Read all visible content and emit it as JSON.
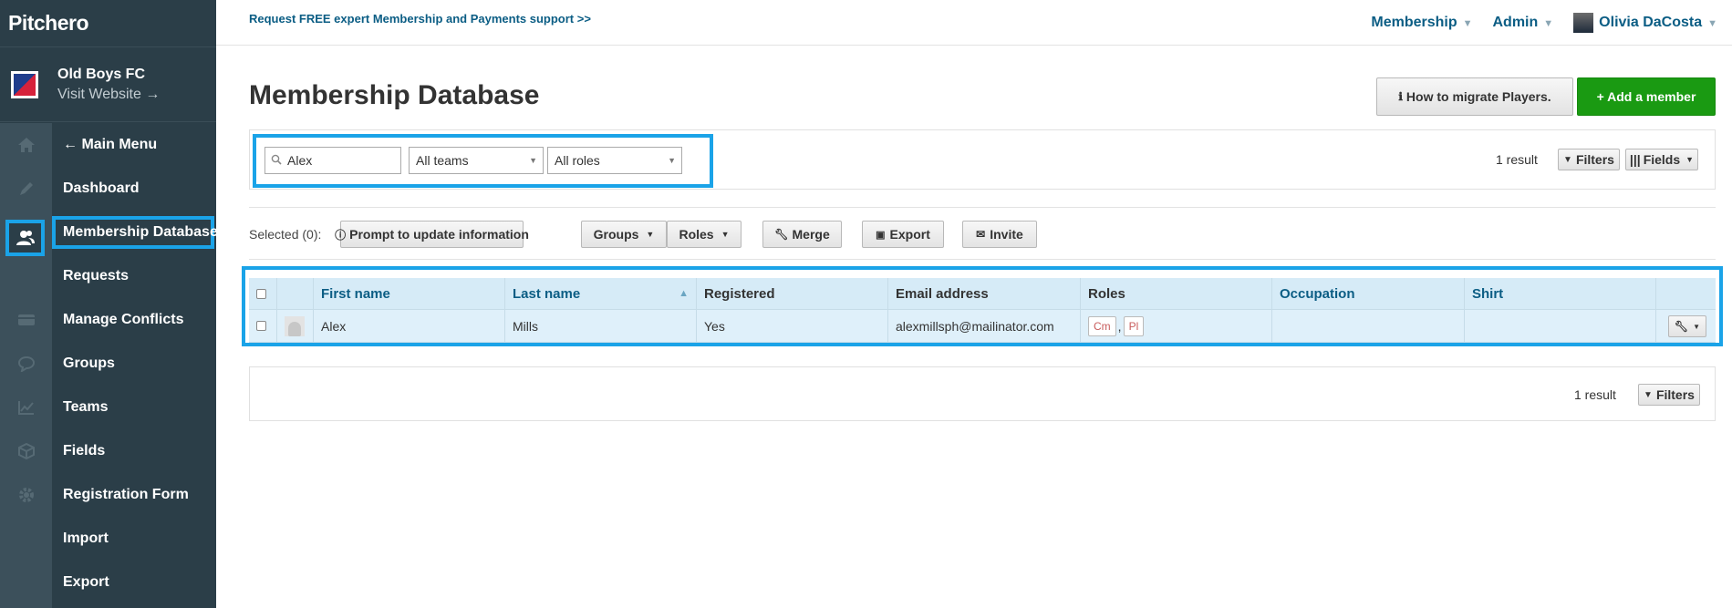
{
  "brand": {
    "name": "Pitchero"
  },
  "club": {
    "name": "Old Boys FC",
    "visit": "Visit Website →"
  },
  "rail_icons": [
    "home-icon",
    "pencil-icon",
    "shirt-icon",
    "users-icon",
    "card-icon",
    "chat-icon",
    "chart-icon",
    "cube-icon",
    "gear-icon"
  ],
  "menu": {
    "back": "← Main Menu",
    "items": [
      "Dashboard",
      "Membership Database",
      "Requests",
      "Manage Conflicts",
      "Groups",
      "Teams",
      "Fields",
      "Registration Form",
      "Import",
      "Export"
    ]
  },
  "topbar": {
    "promo": "Request FREE expert Membership and Payments support >>",
    "nav_membership": "Membership",
    "nav_admin": "Admin",
    "user": "Olivia DaCosta"
  },
  "page": {
    "title": "Membership Database",
    "migrate_btn": "How to migrate Players.",
    "add_btn": "+ Add a member"
  },
  "filters": {
    "search_value": "Alex",
    "teams": "All teams",
    "roles": "All roles",
    "result": "1 result",
    "filters_btn": "Filters",
    "fields_btn": "Fields"
  },
  "actions": {
    "selected": "Selected (0):",
    "prompt": "Prompt to update information",
    "groups": "Groups",
    "roles": "Roles",
    "merge": "Merge",
    "export": "Export",
    "invite": "Invite"
  },
  "table": {
    "headers": [
      "First name",
      "Last name",
      "Registered",
      "Email address",
      "Roles",
      "Occupation",
      "Shirt"
    ],
    "rows": [
      {
        "first": "Alex",
        "last": "Mills",
        "registered": "Yes",
        "email": "alexmillsph@mailinator.com",
        "roles": [
          "Cm",
          "Pl"
        ],
        "occupation": "",
        "shirt": ""
      }
    ]
  },
  "bottom": {
    "result": "1 result",
    "filters_btn": "Filters"
  },
  "colors": {
    "accent": "#1aa3e8",
    "sidebar": "#2b3e48",
    "green": "#1a9a12",
    "link": "#0b5d84"
  }
}
